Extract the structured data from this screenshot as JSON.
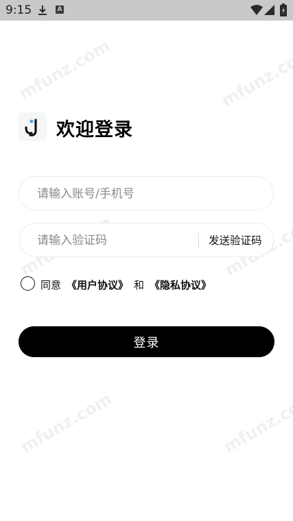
{
  "status_bar": {
    "time": "9:15",
    "icons": [
      "download-icon",
      "a-notification-icon",
      "wifi-icon",
      "signal-icon",
      "battery-icon"
    ],
    "a_badge": "A"
  },
  "watermark": {
    "text": "mfunz.com"
  },
  "header": {
    "logo_icon": "app-logo-icon",
    "title": "欢迎登录"
  },
  "form": {
    "account_placeholder": "请输入账号/手机号",
    "account_value": "",
    "code_placeholder": "请输入验证码",
    "code_value": "",
    "send_code_label": "发送验证码"
  },
  "agreement": {
    "checked": false,
    "prefix": "同意",
    "user_agreement": "《用户协议》",
    "conjunction": "和",
    "privacy_policy": "《隐私协议》"
  },
  "login_button": {
    "label": "登录"
  },
  "colors": {
    "status_bar_bg": "#c9c9c9",
    "primary_button": "#000000",
    "input_border": "#ececec",
    "logo_accent": "#3aa6e0"
  }
}
